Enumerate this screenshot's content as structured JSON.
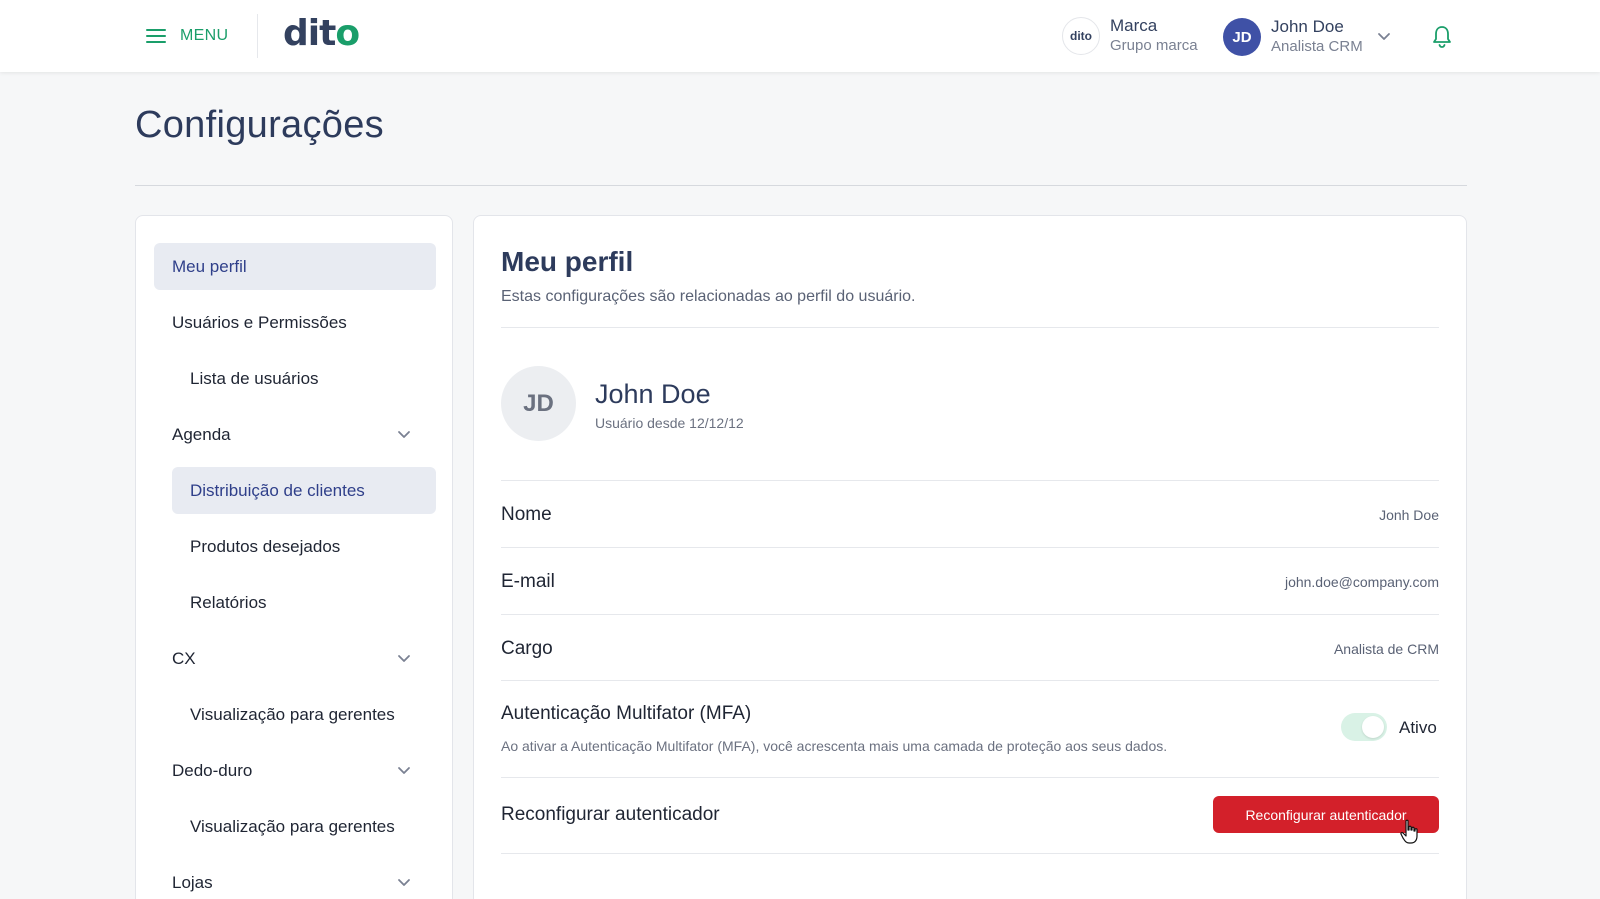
{
  "header": {
    "menu_label": "MENU",
    "logo_text": "dit",
    "logo_dot": "o",
    "brand": {
      "logo_text": "dito",
      "name": "Marca",
      "sub": "Grupo marca"
    },
    "user": {
      "initials": "JD",
      "name": "John Doe",
      "role": "Analista CRM"
    },
    "icons": {
      "menu": "hamburger-icon",
      "chevron": "chevron-down-icon",
      "bell": "bell-icon"
    },
    "accent_color": "#1a9e6a"
  },
  "page": {
    "title": "Configurações"
  },
  "sidebar": {
    "items": [
      {
        "label": "Meu perfil",
        "active": true,
        "level": 0
      },
      {
        "label": "Usuários e Permissões",
        "active": false,
        "level": 0
      },
      {
        "label": "Lista de usuários",
        "active": false,
        "level": 1
      },
      {
        "label": "Agenda",
        "active": false,
        "level": 0,
        "expandable": true
      },
      {
        "label": "Distribuição de clientes",
        "active": true,
        "level": 1
      },
      {
        "label": "Produtos desejados",
        "active": false,
        "level": 1
      },
      {
        "label": "Relatórios",
        "active": false,
        "level": 1
      },
      {
        "label": "CX",
        "active": false,
        "level": 0,
        "expandable": true
      },
      {
        "label": "Visualização para gerentes",
        "active": false,
        "level": 1
      },
      {
        "label": "Dedo-duro",
        "active": false,
        "level": 0,
        "expandable": true
      },
      {
        "label": "Visualização para gerentes",
        "active": false,
        "level": 1
      },
      {
        "label": "Lojas",
        "active": false,
        "level": 0,
        "expandable": true
      }
    ]
  },
  "profile": {
    "title": "Meu perfil",
    "description": "Estas configurações são relacionadas ao perfil do usuário.",
    "avatar_initials": "JD",
    "name": "John Doe",
    "since": "Usuário desde 12/12/12",
    "fields": [
      {
        "label": "Nome",
        "value": "Jonh Doe"
      },
      {
        "label": "E-mail",
        "value": "john.doe@company.com"
      },
      {
        "label": "Cargo",
        "value": "Analista de CRM"
      }
    ],
    "mfa": {
      "label": "Autenticação Multifator (MFA)",
      "description": "Ao ativar a Autenticação Multifator (MFA), você acrescenta mais uma camada de proteção aos seus dados.",
      "status_label": "Ativo",
      "enabled": true
    },
    "reconfigure": {
      "label": "Reconfigurar autenticador",
      "button_label": "Reconfigurar autenticador",
      "button_color": "#d3202a"
    }
  }
}
